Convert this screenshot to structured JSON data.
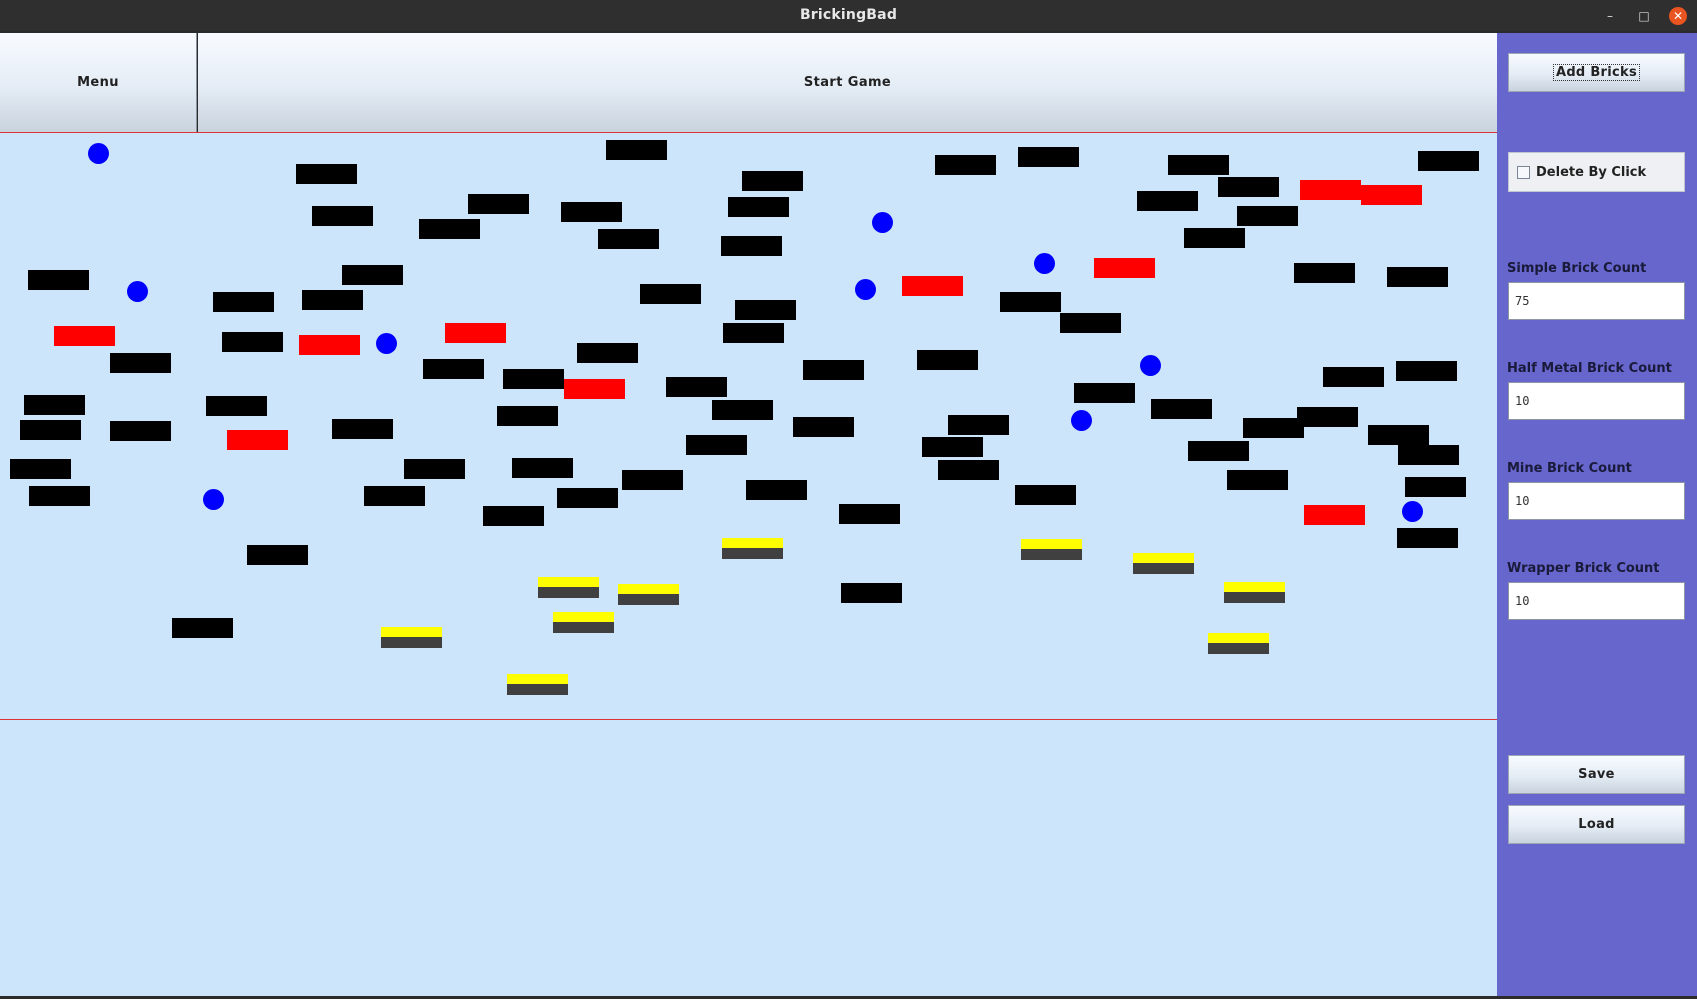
{
  "window": {
    "title": "BrickingBad",
    "minimize_glyph": "–",
    "maximize_glyph": "□",
    "close_glyph": "✕"
  },
  "toolbar": {
    "menu_label": "Menu",
    "start_label": "Start Game"
  },
  "sidebar": {
    "add_bricks_label": "Add Bricks",
    "delete_by_click_label": "Delete By Click",
    "delete_by_click_checked": false,
    "simple_label": "Simple Brick Count",
    "simple_value": "75",
    "half_metal_label": "Half Metal Brick Count",
    "half_metal_value": "10",
    "mine_label": "Mine Brick Count",
    "mine_value": "10",
    "wrapper_label": "Wrapper Brick Count",
    "wrapper_value": "10",
    "save_label": "Save",
    "load_label": "Load"
  },
  "colors": {
    "simple_brick": "#000000",
    "mine_brick": "#ff0000",
    "half_metal_top": "#ffff00",
    "half_metal_bottom": "#404040",
    "wrapper_ball": "#0000ff",
    "playfield": "#cce5fb",
    "sidebar": "#6666cc"
  },
  "icons": {
    "minimize": "minimize-icon",
    "maximize": "maximize-icon",
    "close": "close-icon"
  }
}
